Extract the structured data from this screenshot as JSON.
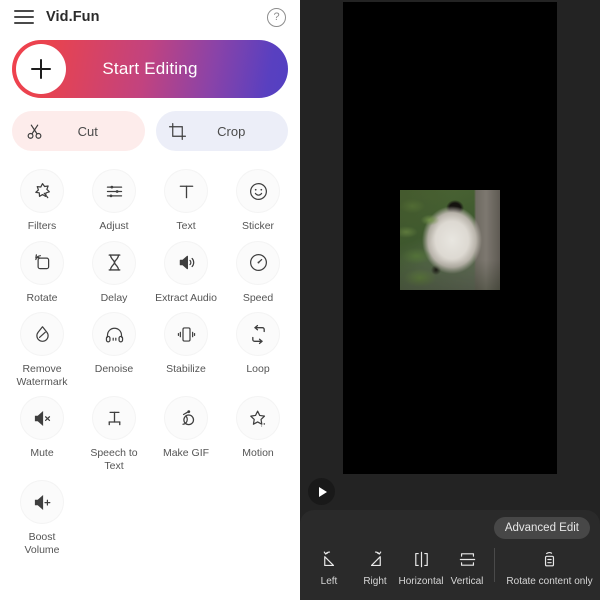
{
  "header": {
    "menu_icon": "hamburger-icon",
    "title": "Vid.Fun",
    "help_icon": "help-circle-icon",
    "help_glyph": "?"
  },
  "start_button": {
    "label": "Start Editing",
    "plus_icon": "plus-icon",
    "gradient_from": "#f0414d",
    "gradient_to": "#5340c2"
  },
  "quick_actions": [
    {
      "label": "Cut",
      "icon": "scissors-icon",
      "bg": "#fdeceb"
    },
    {
      "label": "Crop",
      "icon": "crop-icon",
      "bg": "#eceef8"
    }
  ],
  "tools": [
    {
      "label": "Filters",
      "icon": "magic-wand-icon"
    },
    {
      "label": "Adjust",
      "icon": "sliders-icon"
    },
    {
      "label": "Text",
      "icon": "text-t-icon"
    },
    {
      "label": "Sticker",
      "icon": "smiley-sticker-icon"
    },
    {
      "label": "Rotate",
      "icon": "rotate-square-icon"
    },
    {
      "label": "Delay",
      "icon": "hourglass-icon"
    },
    {
      "label": "Extract Audio",
      "icon": "speaker-wave-icon"
    },
    {
      "label": "Speed",
      "icon": "speedometer-icon"
    },
    {
      "label": "Remove\nWatermark",
      "icon": "droplet-slash-icon"
    },
    {
      "label": "Denoise",
      "icon": "headphones-icon"
    },
    {
      "label": "Stabilize",
      "icon": "stabilize-phone-icon"
    },
    {
      "label": "Loop",
      "icon": "loop-arrows-icon"
    },
    {
      "label": "Mute",
      "icon": "speaker-mute-icon"
    },
    {
      "label": "Speech to\nText",
      "icon": "speech-to-text-icon"
    },
    {
      "label": "Make GIF",
      "icon": "gif-circles-icon"
    },
    {
      "label": "Motion",
      "icon": "star-sparkle-icon"
    },
    {
      "label": "Boost\nVolume",
      "icon": "speaker-plus-icon"
    }
  ],
  "preview": {
    "canvas_bg": "#000000",
    "panel_bg": "#232323",
    "media_description": "panda face among bamboo leaves",
    "play_icon": "play-triangle-icon"
  },
  "bottom_sheet": {
    "advanced_edit_label": "Advanced Edit",
    "rotate_options": [
      {
        "label": "Left",
        "icon": "rotate-left-icon"
      },
      {
        "label": "Right",
        "icon": "rotate-right-icon"
      },
      {
        "label": "Horizontal",
        "icon": "flip-horizontal-icon"
      },
      {
        "label": "Vertical",
        "icon": "flip-vertical-icon"
      }
    ],
    "content_only": {
      "label": "Rotate content only",
      "icon": "rotate-content-icon"
    }
  }
}
